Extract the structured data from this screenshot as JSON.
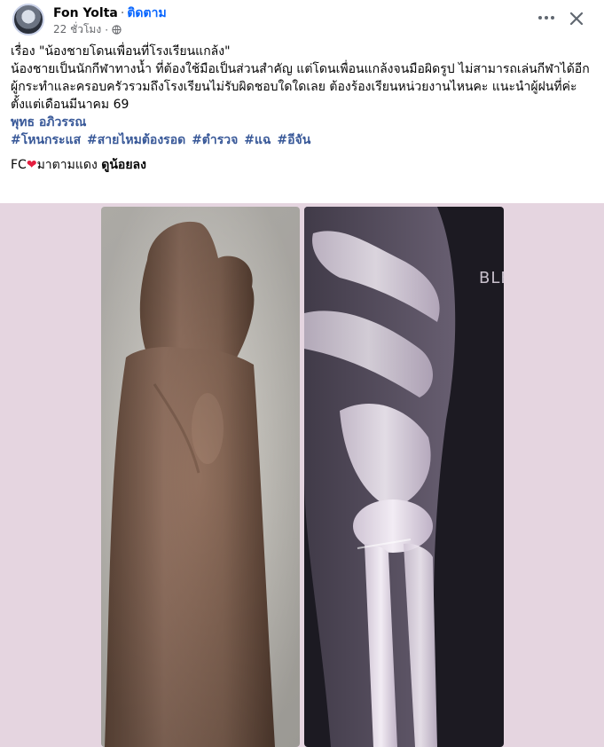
{
  "post": {
    "author": "Fon Yolta",
    "separator": "·",
    "follow_label": "ติดตาม",
    "timestamp": "22 ชั่วโมง",
    "meta_separator": "·",
    "privacy_icon": "globe-icon",
    "more_icon": "more-options-icon",
    "close_icon": "close-icon"
  },
  "content": {
    "title_line": "เรื่อง \"น้องชายโดนเพื่อนที่โรงเรียนแกล้ง\"",
    "body": "น้องชายเป็นนักกีฬาทางน้ำ ที่ต้องใช้มือเป็นส่วนสำคัญ แต่โดนเพื่อนแกล้งจนมือผิดรูป ไม่สามารถเล่นกีฬาได้อีก ผู้กระทำและครอบครัวรวมถึงโรงเรียนไม่รับผิดชอบใดใดเลย ต้องร้องเรียนหน่วยงานไหนคะ แนะนำผู้ฝนที่ค่ะ",
    "since_line": "ตั้งแต่เดือนมีนาคม 69",
    "mention": "พุทธ อภิวรรณ",
    "hashtags": "#โหนกระแส #สายไหมต้องรอด #ตำรวจ #แฉ  #อีจัน",
    "fc_prefix": "FC",
    "fc_middle": "มาตามแดง",
    "fc_bold": "ดูน้อยลง"
  },
  "media": {
    "background_color": "#e5d5e0",
    "photos": [
      {
        "name": "arm-photo",
        "depicts": "arm"
      },
      {
        "name": "xray-photo",
        "depicts": "wrist x-ray",
        "visible_text": "BLE"
      }
    ]
  },
  "colors": {
    "link": "#385898",
    "follow": "#0866ff",
    "heart": "#e41e3f",
    "muted": "#65676b"
  }
}
